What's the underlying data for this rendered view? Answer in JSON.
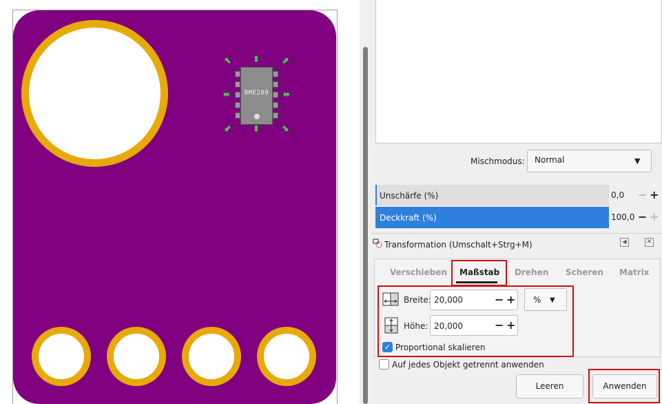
{
  "canvas": {
    "chip_label": "BME280",
    "colors": {
      "board": "#800080",
      "ring": "#e8a90a",
      "handle": "#3fd43f"
    }
  },
  "layers_panel": {
    "blend_label": "Mischmodus:",
    "blend_value": "Normal",
    "blur_label": "Unschärfe (%)",
    "blur_value": "0,0",
    "opacity_label": "Deckkraft (%)",
    "opacity_value": "100,0"
  },
  "transform_panel": {
    "title": "Transformation (Umschalt+Strg+M)",
    "tabs": [
      {
        "label": "Verschieben",
        "active": false
      },
      {
        "label": "Maßstab",
        "active": true
      },
      {
        "label": "Drehen",
        "active": false
      },
      {
        "label": "Scheren",
        "active": false
      },
      {
        "label": "Matrix",
        "active": false
      }
    ],
    "width_label": "Breite:",
    "width_value": "20,000",
    "height_label": "Höhe:",
    "height_value": "20,000",
    "unit": "%",
    "proportional_label": "Proportional skalieren",
    "proportional_checked": true,
    "each_object_label": "Auf jedes Objekt getrennt anwenden",
    "each_object_checked": false,
    "clear_button": "Leeren",
    "apply_button": "Anwenden"
  },
  "colors": {
    "accent": "#2f7fdc",
    "highlight_box": "#d01010"
  }
}
